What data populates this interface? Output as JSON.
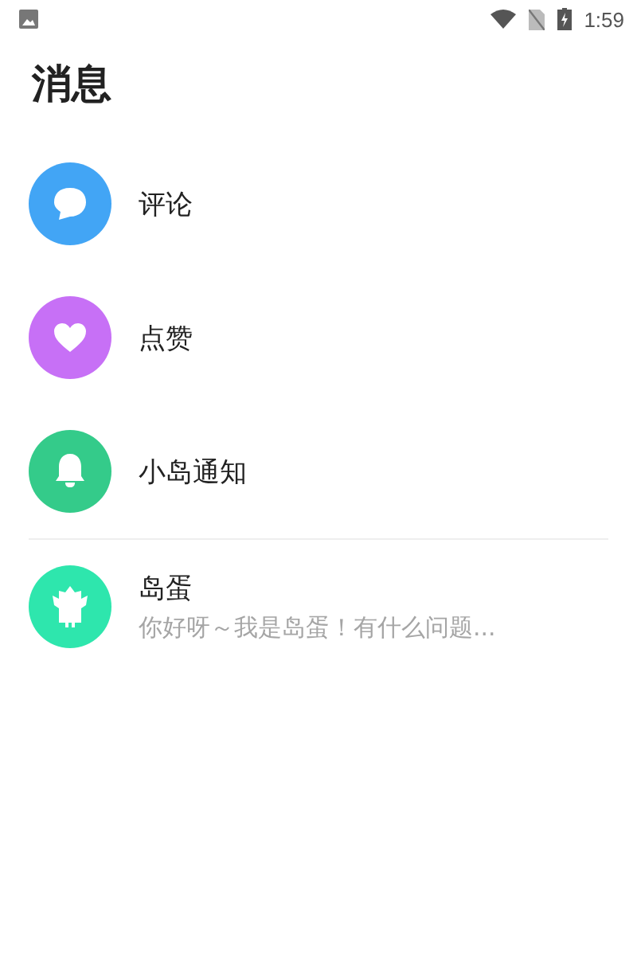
{
  "status_bar": {
    "time": "1:59"
  },
  "title": "消息",
  "items": [
    {
      "kind": "comment",
      "label": "评论",
      "color": "#42a5f5"
    },
    {
      "kind": "like",
      "label": "点赞",
      "color": "#c770f6"
    },
    {
      "kind": "notice",
      "label": "小岛通知",
      "color": "#34cb8a"
    },
    {
      "kind": "chat",
      "label": "岛蛋",
      "preview": "你好呀～我是岛蛋！有什么问题...",
      "color": "#2ee6ad"
    }
  ]
}
